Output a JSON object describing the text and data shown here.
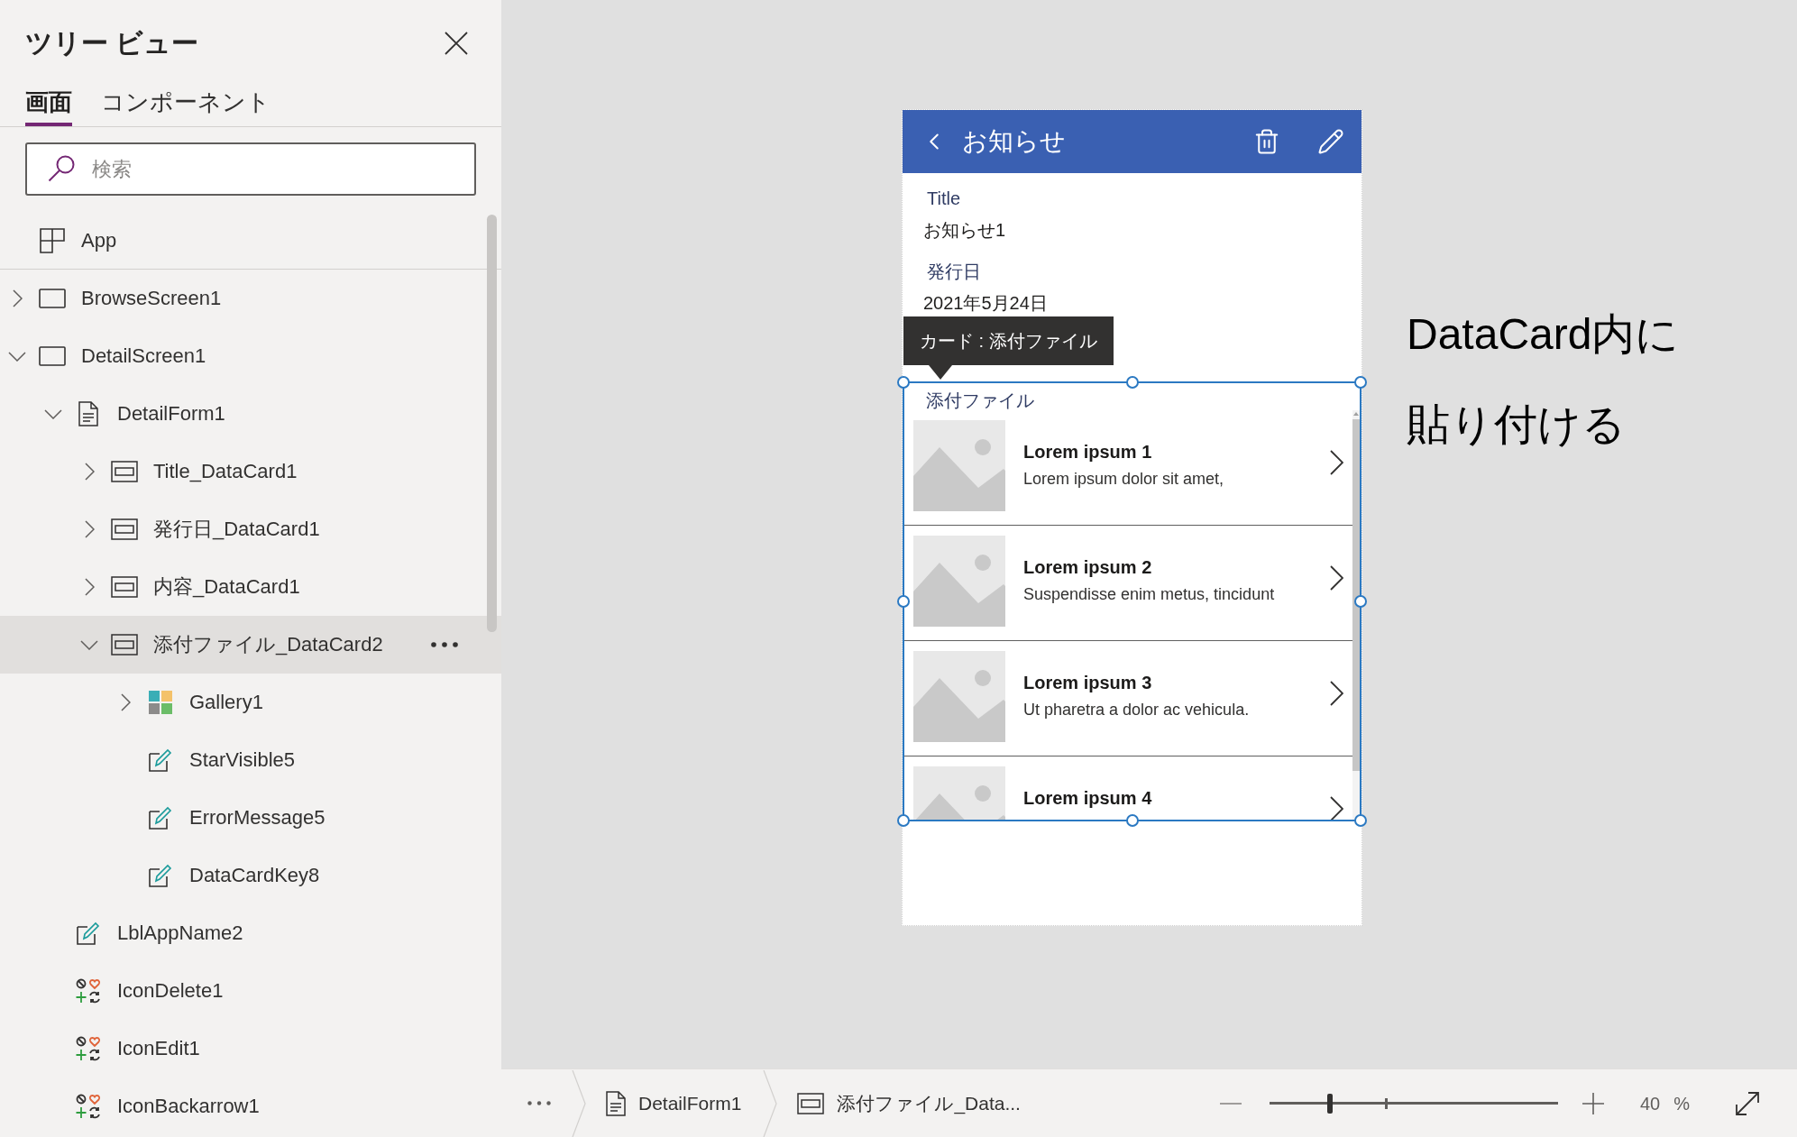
{
  "tree_view": {
    "title": "ツリー ビュー",
    "tabs": [
      {
        "label": "画面",
        "selected": true
      },
      {
        "label": "コンポーネント",
        "selected": false
      }
    ],
    "search": {
      "placeholder": "検索"
    },
    "app_item": {
      "label": "App",
      "kind": "app",
      "selected": false
    },
    "items": [
      {
        "label": "BrowseScreen1",
        "kind": "screen",
        "expanded": false,
        "selected": false
      },
      {
        "label": "DetailScreen1",
        "kind": "screen",
        "expanded": true,
        "selected": false,
        "children": [
          {
            "label": "DetailForm1",
            "kind": "form",
            "expanded": true,
            "selected": false,
            "children": [
              {
                "label": "Title_DataCard1",
                "kind": "card",
                "expanded": false,
                "selected": false
              },
              {
                "label": "発行日_DataCard1",
                "kind": "card",
                "expanded": false,
                "selected": false
              },
              {
                "label": "内容_DataCard1",
                "kind": "card",
                "expanded": false,
                "selected": false
              },
              {
                "label": "添付ファイル_DataCard2",
                "kind": "card",
                "expanded": true,
                "selected": true,
                "children": [
                  {
                    "label": "Gallery1",
                    "kind": "gallery",
                    "expanded": false,
                    "selected": false
                  },
                  {
                    "label": "StarVisible5",
                    "kind": "label",
                    "selected": false
                  },
                  {
                    "label": "ErrorMessage5",
                    "kind": "label",
                    "selected": false
                  },
                  {
                    "label": "DataCardKey8",
                    "kind": "label",
                    "selected": false
                  }
                ]
              }
            ]
          },
          {
            "label": "LblAppName2",
            "kind": "label",
            "selected": false
          },
          {
            "label": "IconDelete1",
            "kind": "icon",
            "selected": false
          },
          {
            "label": "IconEdit1",
            "kind": "icon",
            "selected": false
          },
          {
            "label": "IconBackarrow1",
            "kind": "icon",
            "selected": false
          }
        ]
      }
    ]
  },
  "canvas": {
    "screen": {
      "header": {
        "title": "お知らせ"
      },
      "fields": [
        {
          "label": "Title",
          "value": "お知らせ1"
        },
        {
          "label": "発行日",
          "value": "2021年5月24日"
        }
      ],
      "tooltip": "カード : 添付ファイル",
      "selected_card": {
        "label": "添付ファイル",
        "gallery": [
          {
            "title": "Lorem ipsum 1",
            "subtitle": "Lorem ipsum dolor sit amet,"
          },
          {
            "title": "Lorem ipsum 2",
            "subtitle": "Suspendisse enim metus, tincidunt"
          },
          {
            "title": "Lorem ipsum 3",
            "subtitle": "Ut pharetra a dolor ac vehicula."
          },
          {
            "title": "Lorem ipsum 4"
          }
        ]
      }
    },
    "note": [
      "DataCard内に",
      "貼り付ける"
    ]
  },
  "status_bar": {
    "breadcrumbs": [
      {
        "label": "DetailForm1",
        "kind": "form"
      },
      {
        "label": "添付ファイル_Data...",
        "kind": "card"
      }
    ],
    "zoom": {
      "level": 0.21,
      "value": "40",
      "unit": "%"
    }
  }
}
